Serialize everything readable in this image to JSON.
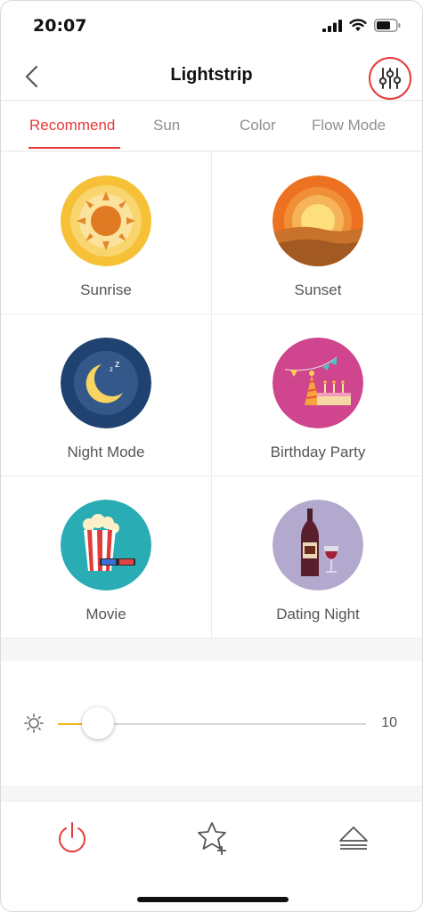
{
  "status_bar": {
    "time": "20:07"
  },
  "nav": {
    "title": "Lightstrip"
  },
  "tabs": [
    {
      "label": "Recommend",
      "active": true
    },
    {
      "label": "Sun",
      "active": false
    },
    {
      "label": "Color",
      "active": false
    },
    {
      "label": "Flow Mode",
      "active": false
    }
  ],
  "scenes": [
    {
      "label": "Sunrise",
      "icon": "sunrise-icon"
    },
    {
      "label": "Sunset",
      "icon": "sunset-icon"
    },
    {
      "label": "Night Mode",
      "icon": "night-mode-icon"
    },
    {
      "label": "Birthday Party",
      "icon": "birthday-party-icon"
    },
    {
      "label": "Movie",
      "icon": "movie-icon"
    },
    {
      "label": "Dating Night",
      "icon": "dating-night-icon"
    }
  ],
  "brightness": {
    "value": "10",
    "fraction": 0.13,
    "icon": "brightness-icon"
  },
  "bottom_bar": {
    "icons": [
      "power-icon",
      "favorite-add-icon",
      "eject-icon"
    ]
  },
  "colors": {
    "accent": "#e83a3a",
    "slider": "#f3b81f"
  }
}
